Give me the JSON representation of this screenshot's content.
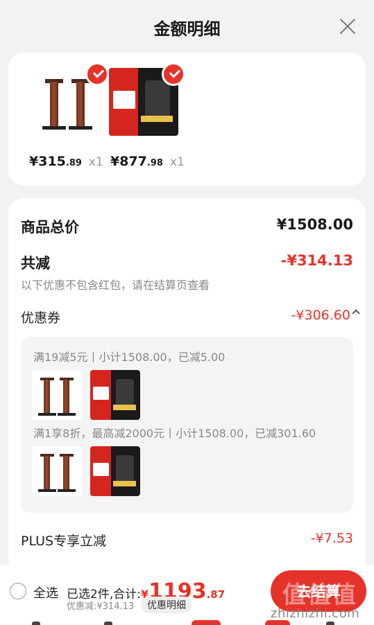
{
  "header": {
    "title": "金额明细"
  },
  "products": [
    {
      "price_main": "¥315",
      "price_dec": ".89",
      "qty": "x1",
      "image": "speaker-stands",
      "selected": true
    },
    {
      "price_main": "¥877",
      "price_dec": ".98",
      "qty": "x1",
      "image": "promo-product",
      "selected": true
    }
  ],
  "detail": {
    "total_label": "商品总价",
    "total_value": "¥1508.00",
    "minus_label": "共减",
    "minus_value": "-¥314.13",
    "note": "以下优惠不包含红包，请在结算页查看",
    "coupon_label": "优惠券",
    "coupon_value": "-¥306.60",
    "coupon_lines": [
      "满19减5元丨小计1508.00，已减5.00",
      "满1享8折，最高减2000元丨小计1508.00，已减301.60"
    ],
    "plus_label": "PLUS专享立减",
    "plus_value": "-¥7.53"
  },
  "bottom": {
    "select_all": "全选",
    "summary_prefix": "已选2件,合计:",
    "amount_currency": "¥",
    "amount_int": "1193",
    "amount_dec": ".87",
    "discount_text": "优惠减:¥314.13",
    "detail_pill": "优惠明细",
    "settle_label": "去结算",
    "watermark_logo": "值值值",
    "watermark_text": "zhizhizhi.com"
  },
  "colors": {
    "accent": "#e6332a",
    "background": "#f2f2f2"
  }
}
